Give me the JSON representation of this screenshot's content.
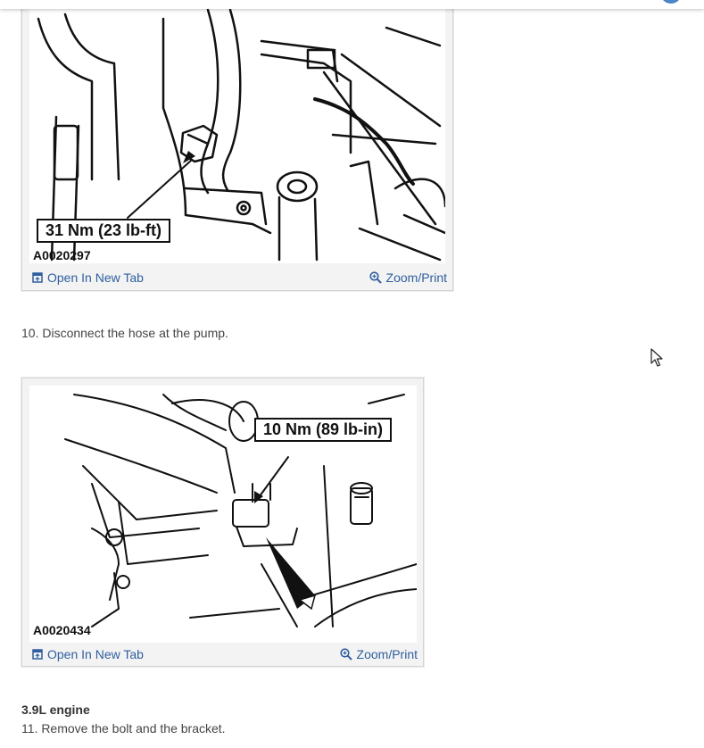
{
  "figures": [
    {
      "image_id": "A0020297",
      "callout": "31 Nm (23 lb-ft)",
      "open_label": "Open In New Tab",
      "zoom_label": "Zoom/Print"
    },
    {
      "image_id": "A0020434",
      "callout": "10 Nm (89 lb-in)",
      "open_label": "Open In New Tab",
      "zoom_label": "Zoom/Print"
    }
  ],
  "steps": {
    "step10": "10. Disconnect the hose at the pump.",
    "engine_heading": "3.9L engine",
    "step11": "11. Remove the bolt and the bracket."
  },
  "icons": {
    "open": "open-in-new-tab-icon",
    "zoom": "magnifier-plus-icon",
    "cursor": "mouse-pointer-icon"
  },
  "colors": {
    "link": "#2f5f9e",
    "figure_bg": "#f3f3f3"
  }
}
